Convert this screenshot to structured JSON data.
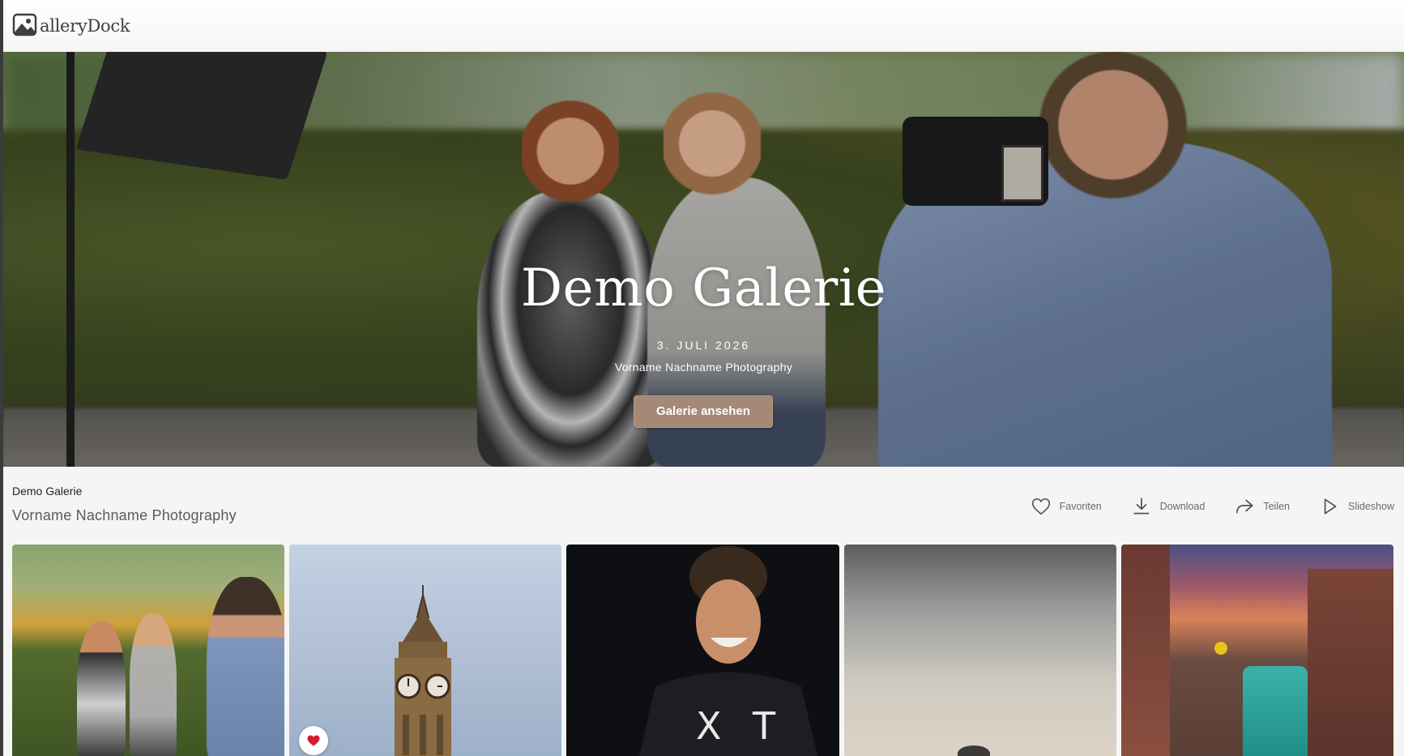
{
  "brand": {
    "logo_text": "alleryDock",
    "logo_icon": "image-icon"
  },
  "hero": {
    "title": "Demo Galerie",
    "date": "3. JULI 2026",
    "studio": "Vorname Nachname Photography",
    "button_label": "Galerie ansehen",
    "button_color": "#a48976"
  },
  "info": {
    "gallery_name": "Demo Galerie",
    "studio_name": "Vorname Nachname Photography"
  },
  "actions": [
    {
      "label": "Favoriten",
      "icon": "heart-icon"
    },
    {
      "label": "Download",
      "icon": "download-icon"
    },
    {
      "label": "Teilen",
      "icon": "share-icon"
    },
    {
      "label": "Slideshow",
      "icon": "play-icon"
    }
  ],
  "thumbnails": [
    {
      "subject": "photoshoot",
      "favorite": false
    },
    {
      "subject": "clock-tower",
      "favorite": true
    },
    {
      "subject": "portrait",
      "favorite": false
    },
    {
      "subject": "cloudy-sky",
      "favorite": false
    },
    {
      "subject": "tram-street",
      "favorite": false
    }
  ],
  "colors": {
    "favorite_heart": "#d0202e",
    "background": "#f6f5f5"
  }
}
